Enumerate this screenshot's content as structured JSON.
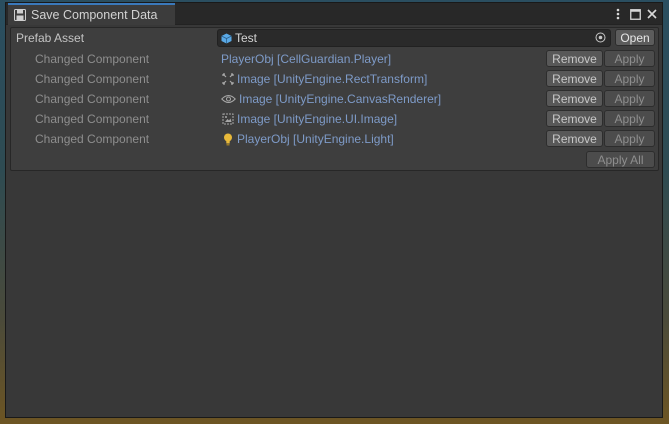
{
  "window": {
    "title": "Save Component Data",
    "controls": {
      "menu_icon": "kebab-menu-icon",
      "maximize_icon": "maximize-icon",
      "close_icon": "close-icon"
    }
  },
  "prefab": {
    "label": "Prefab Asset",
    "value": "Test",
    "open_label": "Open"
  },
  "components": [
    {
      "label": "Changed Component",
      "name": "PlayerObj [CellGuardian.Player]",
      "icon": "none",
      "remove_label": "Remove",
      "apply_label": "Apply"
    },
    {
      "label": "Changed Component",
      "name": "Image [UnityEngine.RectTransform]",
      "icon": "rect-transform-icon",
      "remove_label": "Remove",
      "apply_label": "Apply"
    },
    {
      "label": "Changed Component",
      "name": "Image [UnityEngine.CanvasRenderer]",
      "icon": "eye-icon",
      "remove_label": "Remove",
      "apply_label": "Apply"
    },
    {
      "label": "Changed Component",
      "name": "Image [UnityEngine.UI.Image]",
      "icon": "image-icon",
      "remove_label": "Remove",
      "apply_label": "Apply"
    },
    {
      "label": "Changed Component",
      "name": "PlayerObj [UnityEngine.Light]",
      "icon": "light-bulb-icon",
      "remove_label": "Remove",
      "apply_label": "Apply"
    }
  ],
  "apply_all_label": "Apply All",
  "colors": {
    "accent": "#3a79bb",
    "component_link": "#7e9bc8",
    "light_icon": "#e8b93a",
    "prefab_cube": "#5aa9e6"
  }
}
